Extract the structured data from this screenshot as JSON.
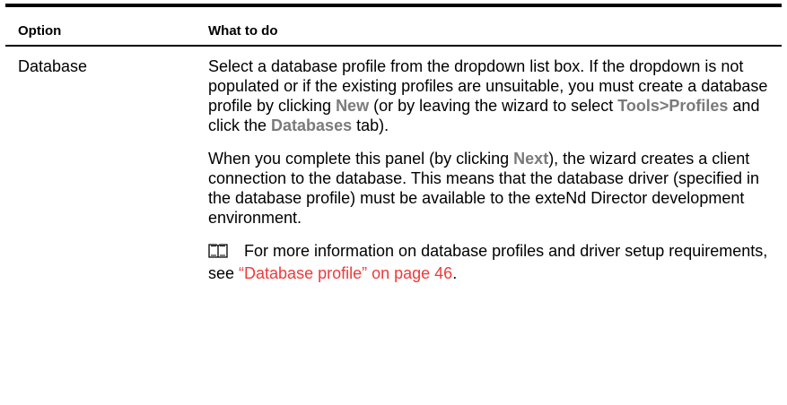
{
  "table": {
    "headers": {
      "option": "Option",
      "what": "What to do"
    },
    "row": {
      "option": "Database",
      "p1": {
        "t1": "Select a database profile from the dropdown list box. If the dropdown is not populated or if the existing profiles are unsuitable, you must create a database profile by clicking ",
        "ui1": "New",
        "t2": " (or by leaving the wizard to select ",
        "ui2": "Tools>Profiles",
        "t3": " and click the ",
        "ui3": "Databases",
        "t4": " tab)."
      },
      "p2": {
        "t1": "When you complete this panel (by clicking ",
        "ui1": "Next",
        "t2": "), the wizard creates a client connection to the database. This means that the database driver (specified in the database profile) must be available to the exteNd Director development environment."
      },
      "p3": {
        "icon": "book-icon",
        "t1": "For more information on database profiles and driver setup requirements, see ",
        "link": "“Database profile” on page 46",
        "t2": "."
      }
    }
  },
  "colors": {
    "ui_label": "#7a7a7a",
    "xref": "#ee3a3a",
    "rule": "#000000"
  }
}
